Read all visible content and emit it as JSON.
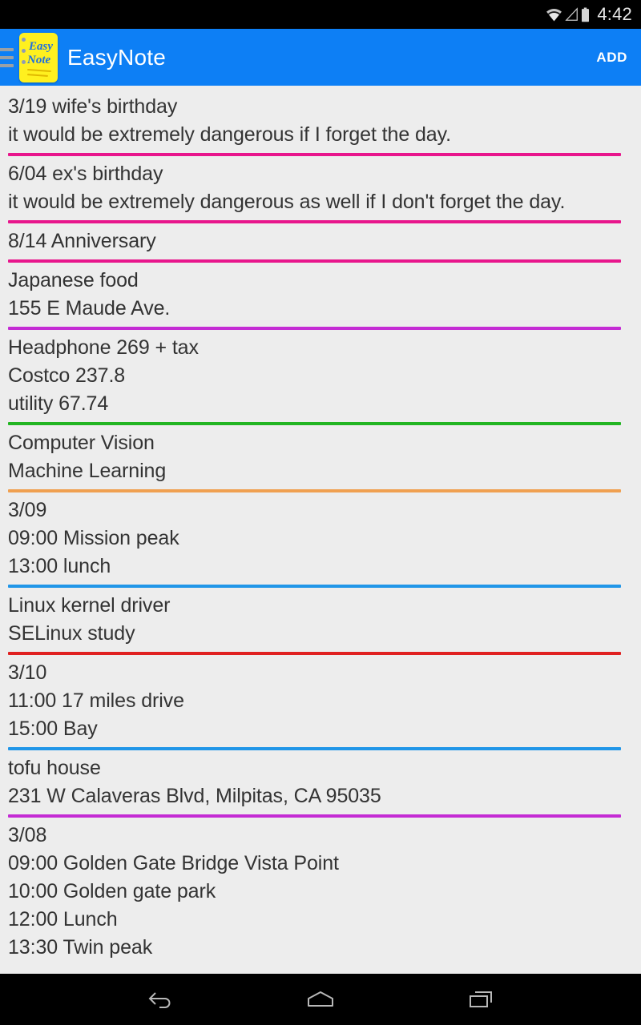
{
  "status_bar": {
    "time": "4:42",
    "icons": [
      "wifi-icon",
      "signal-icon",
      "battery-icon"
    ]
  },
  "action_bar": {
    "drawer_icon": "hamburger-menu-icon",
    "app_icon": {
      "name": "easynote-app-icon",
      "word1": "Easy",
      "word2": "Note"
    },
    "title": "EasyNote",
    "add_label": "ADD",
    "background_color": "#0D7FF5"
  },
  "colors": {
    "pink": "#E8168C",
    "purple": "#C42BD4",
    "green": "#22B522",
    "orange": "#F0A050",
    "blue": "#2196E8",
    "red": "#E02020",
    "list_background": "#EDEDED",
    "text": "#333333"
  },
  "notes": [
    {
      "lines": [
        "3/19 wife's birthday",
        "it would be extremely dangerous if I forget the day."
      ],
      "divider_color": "#E8168C"
    },
    {
      "lines": [
        "6/04 ex's birthday",
        "it would be extremely dangerous as well if I don't forget the day."
      ],
      "divider_color": "#E8168C"
    },
    {
      "lines": [
        "8/14 Anniversary"
      ],
      "divider_color": "#E8168C"
    },
    {
      "lines": [
        "Japanese food",
        "155 E Maude Ave."
      ],
      "divider_color": "#C42BD4"
    },
    {
      "lines": [
        "Headphone 269 + tax",
        "Costco 237.8",
        "utility 67.74"
      ],
      "divider_color": "#22B522"
    },
    {
      "lines": [
        "Computer Vision",
        "Machine Learning"
      ],
      "divider_color": "#F0A050"
    },
    {
      "lines": [
        "3/09",
        "09:00 Mission peak",
        "13:00 lunch"
      ],
      "divider_color": "#2196E8"
    },
    {
      "lines": [
        "Linux kernel driver",
        "SELinux study"
      ],
      "divider_color": "#E02020"
    },
    {
      "lines": [
        "3/10",
        "11:00 17 miles drive",
        "15:00 Bay"
      ],
      "divider_color": "#2196E8"
    },
    {
      "lines": [
        "tofu house",
        "231 W Calaveras Blvd, Milpitas, CA 95035"
      ],
      "divider_color": "#C42BD4"
    },
    {
      "lines": [
        "3/08",
        "09:00 Golden Gate Bridge Vista Point",
        "10:00 Golden gate park",
        "12:00 Lunch",
        "13:30 Twin peak"
      ],
      "divider_color": null
    }
  ],
  "nav_bar": {
    "back_label": "Back",
    "home_label": "Home",
    "recents_label": "Recent apps"
  }
}
